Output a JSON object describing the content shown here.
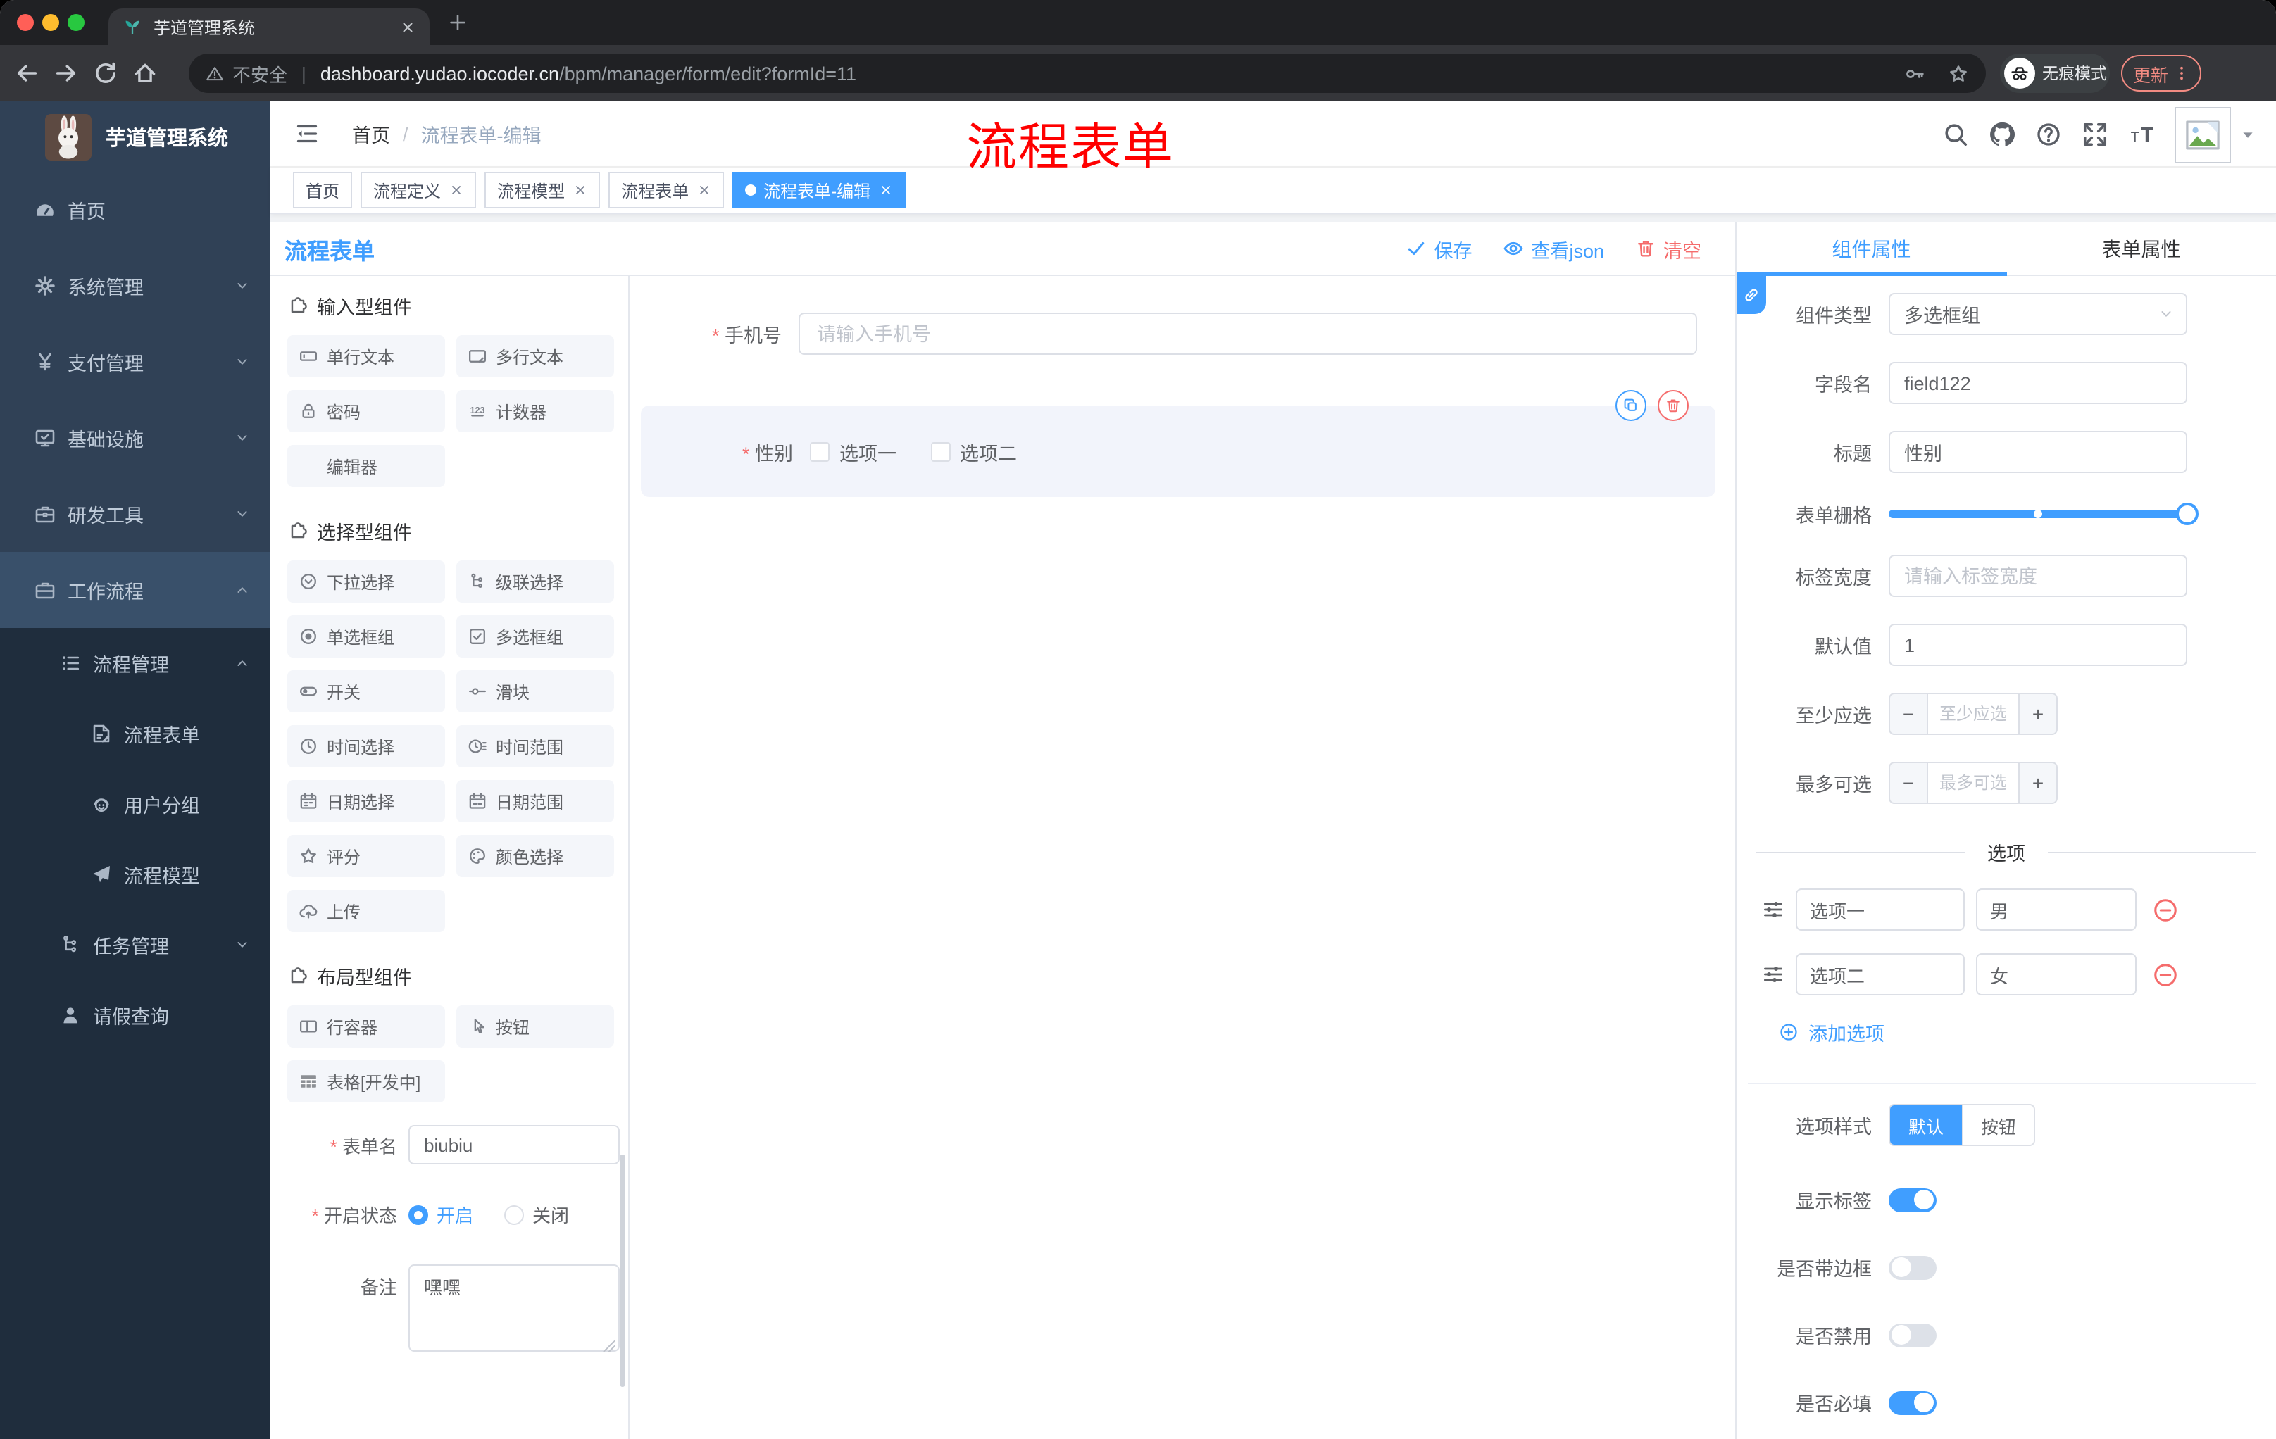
{
  "colors": {
    "accent": "#409eff",
    "danger": "#f56c6c",
    "chrome_update": "#f28b82",
    "sidebar_bg": "#304156",
    "sidebar_sub_bg": "#1f2d3d",
    "annotation": "#ff0000"
  },
  "browser": {
    "tab_title": "芋道管理系统",
    "security_label": "不安全",
    "url_host": "dashboard.yudao.iocoder.cn",
    "url_path": "/bpm/manager/form/edit?formId=11",
    "incognito_label": "无痕模式",
    "update_label": "更新"
  },
  "annotation": {
    "text": "流程表单"
  },
  "sidebar": {
    "logo_title": "芋道管理系统",
    "items": [
      {
        "label": "首页",
        "icon": "dashboard-icon",
        "depth": 0,
        "arrow": "",
        "submenu": false,
        "highlight": false
      },
      {
        "label": "系统管理",
        "icon": "gear-icon",
        "depth": 0,
        "arrow": "down",
        "submenu": false,
        "highlight": false
      },
      {
        "label": "支付管理",
        "icon": "yen-icon",
        "depth": 0,
        "arrow": "down",
        "submenu": false,
        "highlight": false
      },
      {
        "label": "基础设施",
        "icon": "monitor-icon",
        "depth": 0,
        "arrow": "down",
        "submenu": false,
        "highlight": false
      },
      {
        "label": "研发工具",
        "icon": "toolbox-icon",
        "depth": 0,
        "arrow": "down",
        "submenu": false,
        "highlight": false
      },
      {
        "label": "工作流程",
        "icon": "briefcase-icon",
        "depth": 0,
        "arrow": "up",
        "submenu": false,
        "highlight": true
      },
      {
        "label": "流程管理",
        "icon": "list-icon",
        "depth": 1,
        "arrow": "up",
        "submenu": true,
        "highlight": false
      },
      {
        "label": "流程表单",
        "icon": "form-doc-icon",
        "depth": 2,
        "arrow": "",
        "submenu": true,
        "highlight": false
      },
      {
        "label": "用户分组",
        "icon": "face-icon",
        "depth": 2,
        "arrow": "",
        "submenu": true,
        "highlight": false
      },
      {
        "label": "流程模型",
        "icon": "paper-plane-icon",
        "depth": 2,
        "arrow": "",
        "submenu": true,
        "highlight": false
      },
      {
        "label": "任务管理",
        "icon": "tree-icon",
        "depth": 1,
        "arrow": "down",
        "submenu": true,
        "highlight": false
      },
      {
        "label": "请假查询",
        "icon": "user-icon",
        "depth": 1,
        "arrow": "",
        "submenu": true,
        "highlight": false
      }
    ]
  },
  "header": {
    "breadcrumb_1": "首页",
    "breadcrumb_2": "流程表单-编辑"
  },
  "tags": {
    "items": [
      {
        "label": "首页",
        "closable": false,
        "active": false
      },
      {
        "label": "流程定义",
        "closable": true,
        "active": false
      },
      {
        "label": "流程模型",
        "closable": true,
        "active": false
      },
      {
        "label": "流程表单",
        "closable": true,
        "active": false
      },
      {
        "label": "流程表单-编辑",
        "closable": true,
        "active": true
      }
    ]
  },
  "toolbar": {
    "title": "流程表单",
    "save_label": "保存",
    "view_json_label": "查看json",
    "clear_label": "清空"
  },
  "palette": {
    "sections": [
      {
        "title": "输入型组件",
        "items": [
          {
            "label": "单行文本",
            "icon": "input-icon"
          },
          {
            "label": "多行文本",
            "icon": "textarea-icon"
          },
          {
            "label": "密码",
            "icon": "lock-icon"
          },
          {
            "label": "计数器",
            "icon": "counter-icon"
          },
          {
            "label": "编辑器",
            "icon": ""
          }
        ]
      },
      {
        "title": "选择型组件",
        "items": [
          {
            "label": "下拉选择",
            "icon": "select-icon"
          },
          {
            "label": "级联选择",
            "icon": "cascade-icon"
          },
          {
            "label": "单选框组",
            "icon": "radio-icon"
          },
          {
            "label": "多选框组",
            "icon": "checkbox-icon"
          },
          {
            "label": "开关",
            "icon": "switch-icon"
          },
          {
            "label": "滑块",
            "icon": "slider-icon"
          },
          {
            "label": "时间选择",
            "icon": "time-icon"
          },
          {
            "label": "时间范围",
            "icon": "time-range-icon"
          },
          {
            "label": "日期选择",
            "icon": "date-icon"
          },
          {
            "label": "日期范围",
            "icon": "date-range-icon"
          },
          {
            "label": "评分",
            "icon": "star-icon"
          },
          {
            "label": "颜色选择",
            "icon": "palette-icon"
          },
          {
            "label": "上传",
            "icon": "upload-icon"
          }
        ]
      },
      {
        "title": "布局型组件",
        "items": [
          {
            "label": "行容器",
            "icon": "row-icon"
          },
          {
            "label": "按钮",
            "icon": "pointer-icon"
          },
          {
            "label": "表格[开发中]",
            "icon": "table-icon"
          }
        ]
      }
    ]
  },
  "canvas": {
    "phone_label": "手机号",
    "phone_placeholder": "请输入手机号",
    "gender_label": "性别",
    "gender_options": [
      "选项一",
      "选项二"
    ]
  },
  "form_config": {
    "name_label": "表单名",
    "name_value": "biubiu",
    "status_label": "开启状态",
    "status_options": [
      "开启",
      "关闭"
    ],
    "status_selected": "开启",
    "remark_label": "备注",
    "remark_value": "嘿嘿"
  },
  "properties": {
    "tab_component": "组件属性",
    "tab_form": "表单属性",
    "component_type_label": "组件类型",
    "component_type_value": "多选框组",
    "field_name_label": "字段名",
    "field_name_value": "field122",
    "title_label": "标题",
    "title_value": "性别",
    "grid_label": "表单栅格",
    "label_width_label": "标签宽度",
    "label_width_placeholder": "请输入标签宽度",
    "default_label": "默认值",
    "default_value": "1",
    "min_label": "至少应选",
    "min_placeholder": "至少应选",
    "max_label": "最多可选",
    "max_placeholder": "最多可选",
    "options_divider": "选项",
    "options": [
      {
        "label": "选项一",
        "value": "男"
      },
      {
        "label": "选项二",
        "value": "女"
      }
    ],
    "add_option_label": "添加选项",
    "style_label": "选项样式",
    "style_options": [
      "默认",
      "按钮"
    ],
    "style_selected": "默认",
    "toggles": [
      {
        "label": "显示标签",
        "on": true
      },
      {
        "label": "是否带边框",
        "on": false
      },
      {
        "label": "是否禁用",
        "on": false
      },
      {
        "label": "是否必填",
        "on": true
      }
    ]
  }
}
